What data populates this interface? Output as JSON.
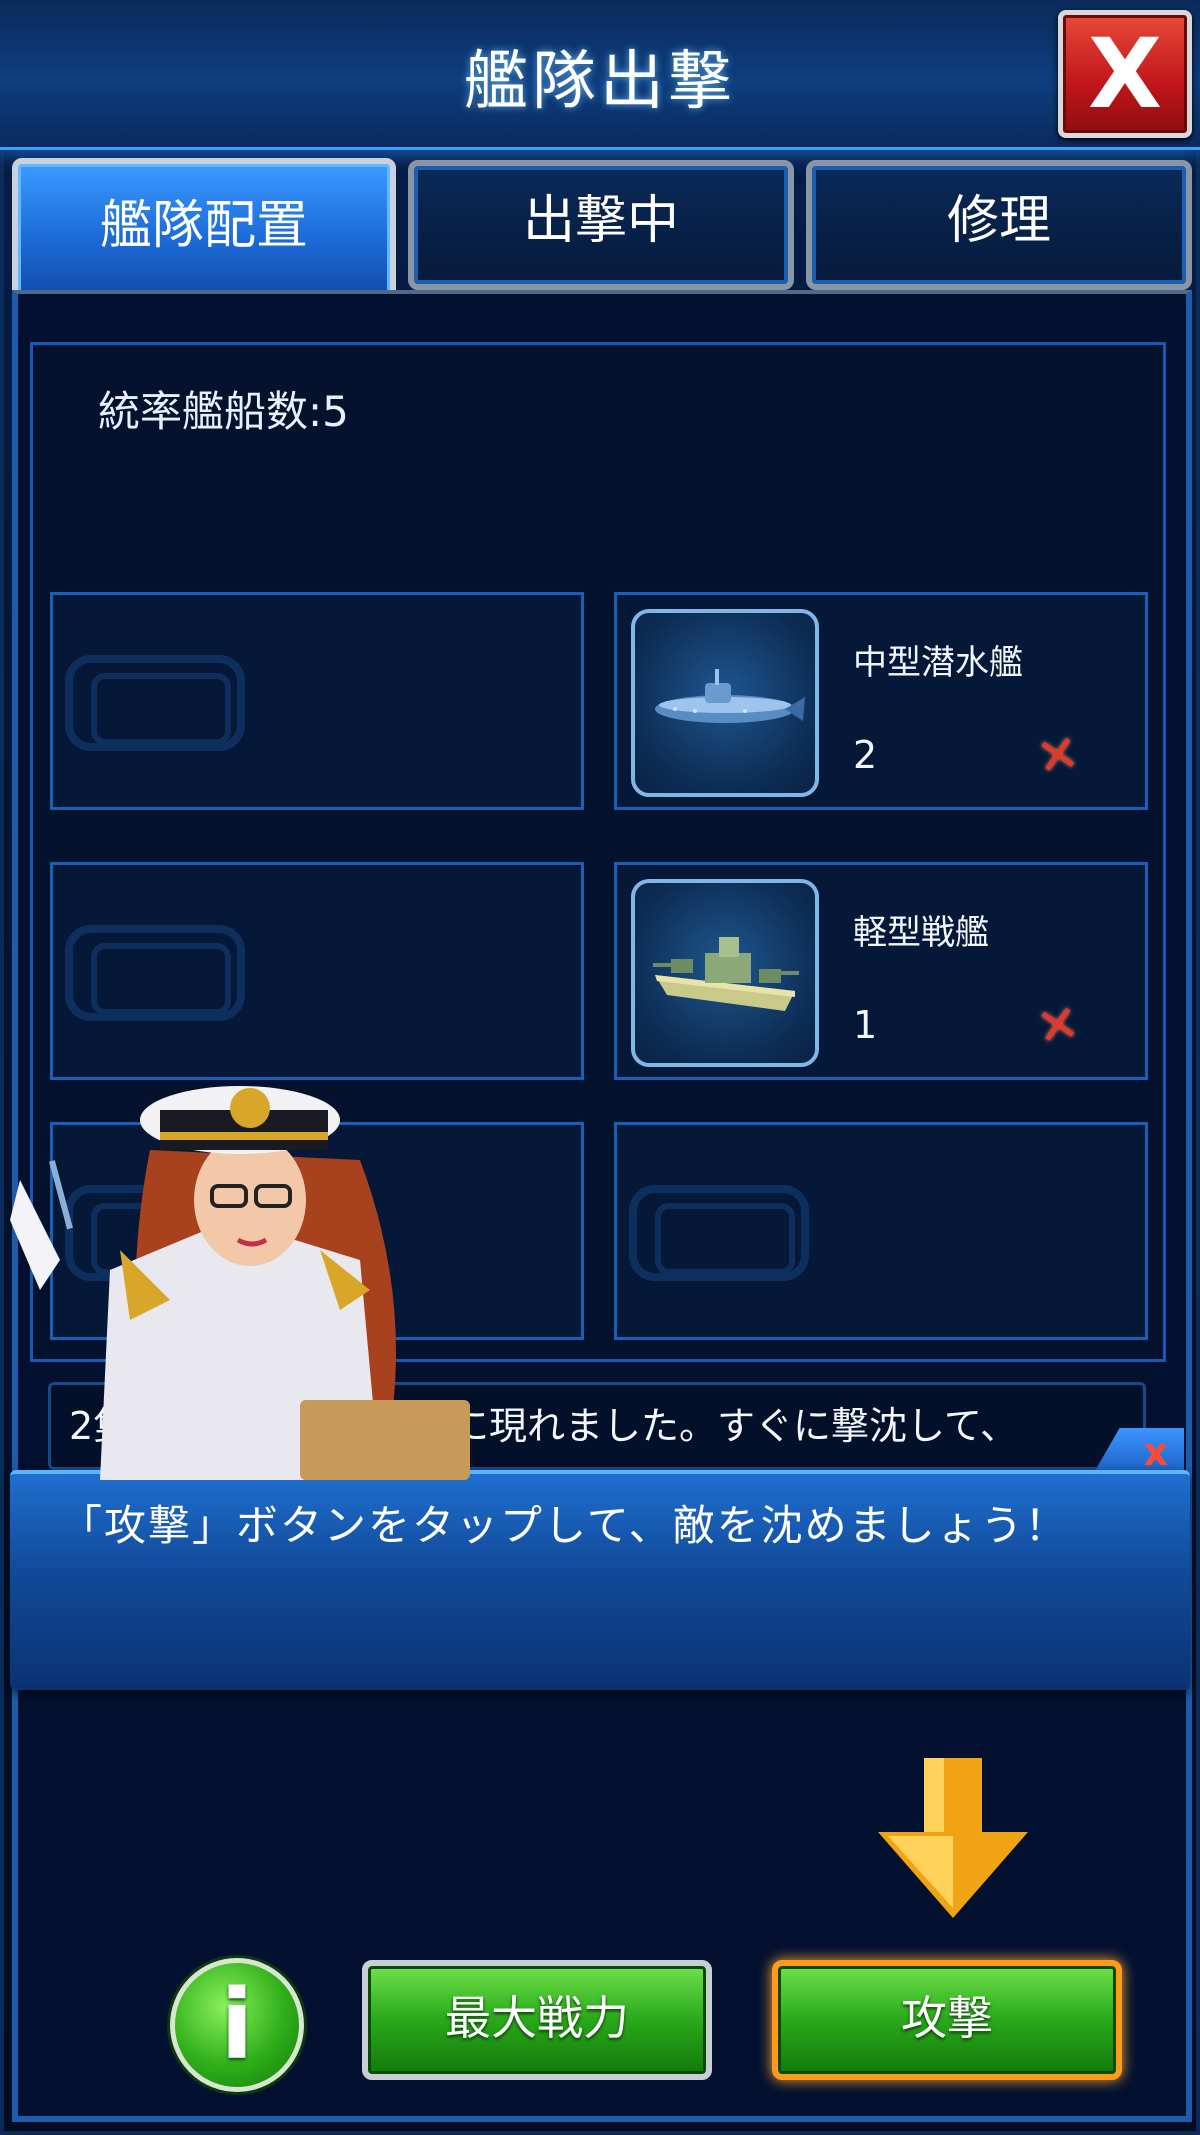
{
  "header": {
    "title": "艦隊出撃",
    "close_label": "X"
  },
  "tabs": [
    {
      "label": "艦隊配置",
      "active": true
    },
    {
      "label": "出撃中",
      "active": false
    },
    {
      "label": "修理",
      "active": false
    }
  ],
  "fleet": {
    "command_label": "統率艦船数:5",
    "slots": [
      {
        "state": "empty"
      },
      {
        "state": "filled",
        "name": "中型潜水艦",
        "count": "2",
        "icon": "submarine-icon"
      },
      {
        "state": "empty"
      },
      {
        "state": "filled",
        "name": "軽型戦艦",
        "count": "1",
        "icon": "battleship-icon"
      },
      {
        "state": "empty"
      },
      {
        "state": "empty"
      }
    ],
    "remove_glyph": "✕"
  },
  "story": {
    "prefix": "2隻",
    "text": "に現れました。すぐに撃沈して、"
  },
  "tip": {
    "text": "「攻撃」ボタンをタップして、敵を沈めましょう！",
    "close_label": "x"
  },
  "buttons": {
    "info_label": "i",
    "max_power_label": "最大戦力",
    "attack_label": "攻撃"
  },
  "colors": {
    "accent_blue": "#1a5fb8",
    "attack_glow": "#ffa92a",
    "remove_red": "#e23a2a",
    "green_button": "#2aa81a"
  }
}
